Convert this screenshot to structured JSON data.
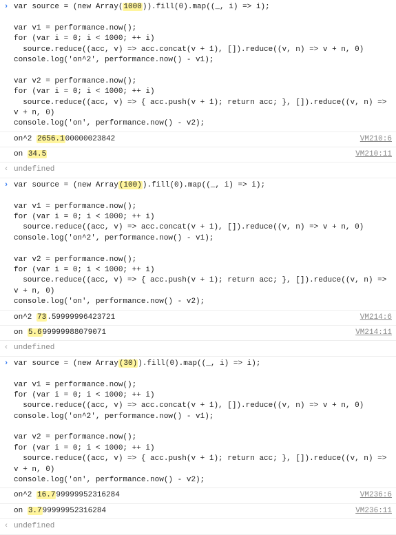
{
  "blocks": [
    {
      "code": {
        "t_array_open": "var source = (new Array(",
        "t_array_hl": "1000",
        "t_array_close": ")).fill(0).map((_, i) => i);",
        "t_v1": "var v1 = performance.now();",
        "t_for1": "for (var i = 0; i < 1000; ++ i)",
        "t_red1": "  source.reduce((acc, v) => acc.concat(v + 1), []).reduce((v, n) => v + n, 0)",
        "t_log1": "console.log('on^2', performance.now() - v1);",
        "t_v2": "var v2 = performance.now();",
        "t_for2": "for (var i = 0; i < 1000; ++ i)",
        "t_red2a": "  source.reduce((acc, v) => { acc.push(v + 1); return acc; }, []).reduce((v, n) => v + n, 0)",
        "t_log2": "console.log('on', performance.now() - v2);"
      },
      "out1": {
        "label": "on^2 ",
        "hl": "2656.1",
        "rest": "00000023842",
        "src": "VM210:6"
      },
      "out2": {
        "label": "on ",
        "hl": "34.5",
        "rest": "",
        "src": "VM210:11"
      },
      "ret": "undefined"
    },
    {
      "code": {
        "t_array_open": "var source = (new Array",
        "t_array_hl": "(100)",
        "t_array_close": ").fill(0).map((_, i) => i);",
        "t_v1": "var v1 = performance.now();",
        "t_for1": "for (var i = 0; i < 1000; ++ i)",
        "t_red1": "  source.reduce((acc, v) => acc.concat(v + 1), []).reduce((v, n) => v + n, 0)",
        "t_log1": "console.log('on^2', performance.now() - v1);",
        "t_v2": "var v2 = performance.now();",
        "t_for2": "for (var i = 0; i < 1000; ++ i)",
        "t_red2a": "  source.reduce((acc, v) => { acc.push(v + 1); return acc; }, []).reduce((v, n) => v + n, 0)",
        "t_log2": "console.log('on', performance.now() - v2);"
      },
      "out1": {
        "label": "on^2 ",
        "hl": "73",
        "rest": ".59999996423721",
        "src": "VM214:6"
      },
      "out2": {
        "label": "on ",
        "hl": "5.6",
        "rest": "99999988079071",
        "src": "VM214:11"
      },
      "ret": "undefined"
    },
    {
      "code": {
        "t_array_open": "var source = (new Array",
        "t_array_hl": "(30)",
        "t_array_close": ").fill(0).map((_, i) => i);",
        "t_v1": "var v1 = performance.now();",
        "t_for1": "for (var i = 0; i < 1000; ++ i)",
        "t_red1": "  source.reduce((acc, v) => acc.concat(v + 1), []).reduce((v, n) => v + n, 0)",
        "t_log1": "console.log('on^2', performance.now() - v1);",
        "t_v2": "var v2 = performance.now();",
        "t_for2": "for (var i = 0; i < 1000; ++ i)",
        "t_red2a": "  source.reduce((acc, v) => { acc.push(v + 1); return acc; }, []).reduce((v, n) => v + n, 0)",
        "t_log2": "console.log('on', performance.now() - v2);"
      },
      "out1": {
        "label": "on^2 ",
        "hl": "16.7",
        "rest": "99999952316284",
        "src": "VM236:6"
      },
      "out2": {
        "label": "on ",
        "hl": "3.7",
        "rest": "99999952316284",
        "src": "VM236:11"
      },
      "ret": "undefined"
    }
  ]
}
